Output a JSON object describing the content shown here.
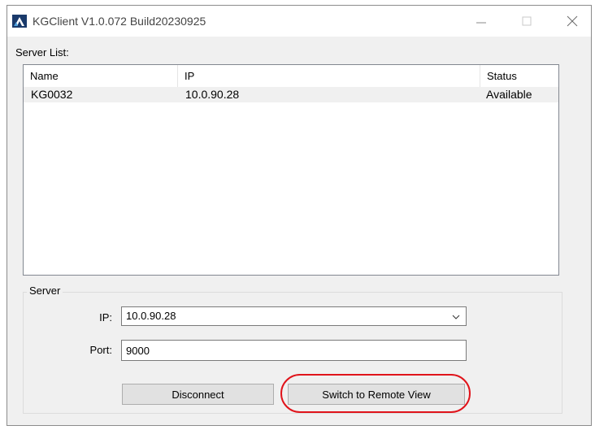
{
  "window": {
    "title": "KGClient V1.0.072 Build20230925"
  },
  "icons": {
    "app": "app-logo-icon",
    "minimize": "minimize-icon",
    "maximize": "maximize-icon",
    "close": "close-icon",
    "dropdown": "chevron-down-icon"
  },
  "server_list": {
    "label": "Server List:",
    "columns": [
      "Name",
      "IP",
      "Status"
    ],
    "rows": [
      {
        "name": "KG0032",
        "ip": "10.0.90.28",
        "status": "Available"
      }
    ]
  },
  "server": {
    "group_label": "Server",
    "ip_label": "IP:",
    "ip_value": "10.0.90.28",
    "port_label": "Port:",
    "port_value": "9000"
  },
  "buttons": {
    "disconnect": "Disconnect",
    "switch_remote": "Switch to Remote View"
  },
  "colors": {
    "highlight": "#e0141b",
    "selected_row": "#f0f0f0"
  }
}
